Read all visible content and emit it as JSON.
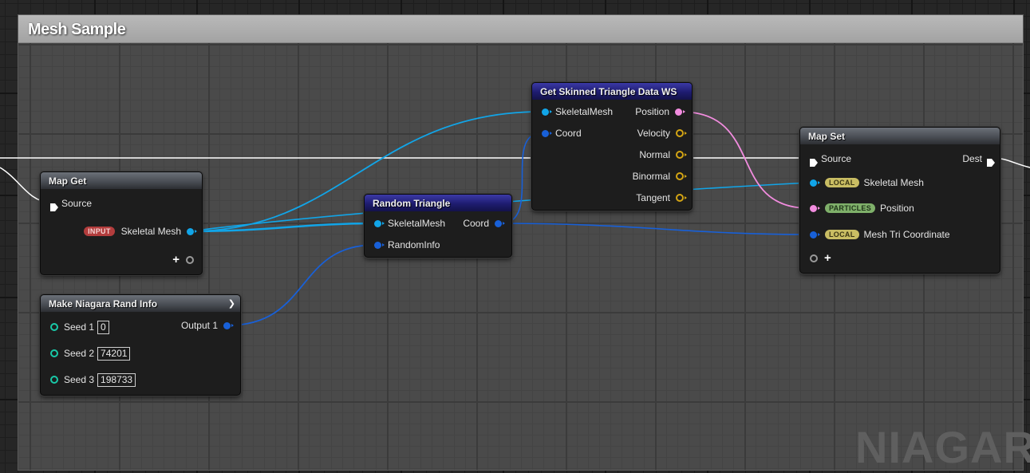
{
  "comment": {
    "title": "Mesh Sample",
    "watermark": "NIAGARA"
  },
  "nodes": {
    "map_get": {
      "title": "Map Get",
      "source_label": "Source",
      "badge": "INPUT",
      "output_label": "Skeletal Mesh",
      "add_pin": "+"
    },
    "rand_info": {
      "title": "Make Niagara Rand Info",
      "seeds": [
        {
          "label": "Seed 1",
          "value": "0"
        },
        {
          "label": "Seed 2",
          "value": "74201"
        },
        {
          "label": "Seed 3",
          "value": "198733"
        }
      ],
      "output_label": "Output 1"
    },
    "random_triangle": {
      "title": "Random Triangle",
      "inputs": [
        "SkeletalMesh",
        "RandomInfo"
      ],
      "output_label": "Coord"
    },
    "skinned": {
      "title": "Get Skinned Triangle Data WS",
      "inputs": [
        "SkeletalMesh",
        "Coord"
      ],
      "outputs": [
        "Position",
        "Velocity",
        "Normal",
        "Binormal",
        "Tangent"
      ]
    },
    "map_set": {
      "title": "Map Set",
      "source_label": "Source",
      "dest_label": "Dest",
      "pins": [
        {
          "badge": "LOCAL",
          "label": "Skeletal Mesh"
        },
        {
          "badge": "PARTICLES",
          "label": "Position"
        },
        {
          "badge": "LOCAL",
          "label": "Mesh Tri Coordinate"
        }
      ],
      "add_pin": "+"
    }
  },
  "colors": {
    "mesh_pin": "#11a5e8",
    "struct_pin": "#1860d8",
    "position_pin": "#f28cdf",
    "vector_pin": "#d4a514",
    "int_pin": "#19c9a8",
    "exec_wire": "#ffffff",
    "header_blue": "#1e1c70",
    "header_gray": "#4a4e55"
  },
  "icons": {
    "exec": "exec-arrow-icon",
    "dropdown": "chevron-down-icon",
    "add": "plus-icon"
  }
}
